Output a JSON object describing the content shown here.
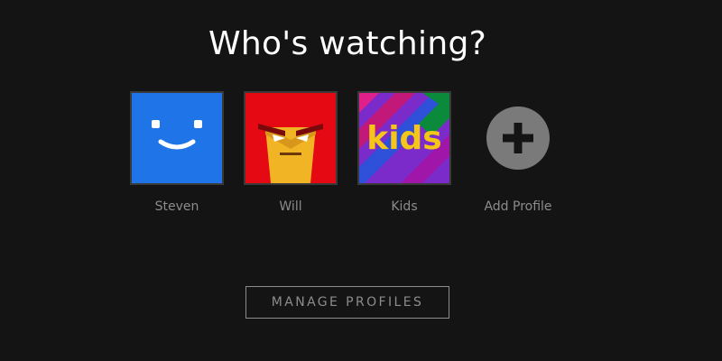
{
  "heading": "Who's watching?",
  "profiles": [
    {
      "name": "Steven",
      "avatar_icon": "smiley-face-icon",
      "color": "#1f74e8"
    },
    {
      "name": "Will",
      "avatar_icon": "angry-face-icon",
      "color": "#e50914"
    },
    {
      "name": "Kids",
      "avatar_icon": "kids-logo-icon",
      "color": "#7b2bc9"
    }
  ],
  "add_profile": {
    "label": "Add Profile",
    "icon": "plus-circle-icon"
  },
  "manage_button": {
    "label": "MANAGE PROFILES"
  },
  "colors": {
    "background": "#141414",
    "title": "#ffffff",
    "muted_text": "#8c8c8c"
  }
}
